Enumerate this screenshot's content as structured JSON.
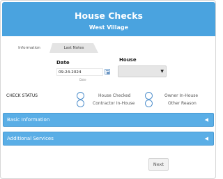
{
  "header": {
    "title": "House Checks",
    "subtitle": "West Village"
  },
  "tabs": [
    {
      "label": "Information",
      "active": true
    },
    {
      "label": "Last Notes",
      "active": false
    }
  ],
  "form": {
    "date_label": "Date",
    "date_value": "09-24-2024",
    "date_hint": "Date",
    "house_label": "House",
    "house_value": ""
  },
  "check_status": {
    "label": "CHECK STATUS",
    "options": [
      {
        "label": "House Checked"
      },
      {
        "label": "Owner In-House"
      },
      {
        "label": "Contractor In-House"
      },
      {
        "label": "Other Reason"
      }
    ]
  },
  "sections": [
    {
      "label": "Basic Information"
    },
    {
      "label": "Additional Services"
    }
  ],
  "actions": {
    "next_label": "Next"
  },
  "colors": {
    "header": "#4aa3df",
    "accordion": "#5aaee6",
    "radio_border": "#4f8fcc"
  },
  "icons": {
    "calendar": "calendar-icon",
    "select_arrow": "chevron-down-icon",
    "accordion": "caret-left-icon"
  }
}
